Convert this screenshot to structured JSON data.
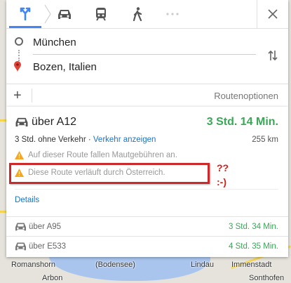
{
  "map": {
    "labels": [
      "Romanshorn",
      "(Bodensee)",
      "Lindau",
      "Immenstadt",
      "Arbon",
      "Sonthofen"
    ]
  },
  "modes": [
    {
      "name": "best-mode-icon",
      "active": true
    },
    {
      "name": "car-icon",
      "active": false
    },
    {
      "name": "transit-icon",
      "active": false
    },
    {
      "name": "walk-icon",
      "active": false
    },
    {
      "name": "more-icon",
      "active": false
    }
  ],
  "waypoints": {
    "origin": "München",
    "destination": "Bozen, Italien"
  },
  "options": {
    "route_options_label": "Routenoptionen"
  },
  "route1": {
    "via": "über A12",
    "time": "3 Std. 14 Min.",
    "traffic_note": "3 Std. ohne Verkehr ·",
    "traffic_link": "Verkehr anzeigen",
    "distance": "255 km",
    "warning_toll": "Auf dieser Route fallen Mautgebühren an.",
    "warning_austria": "Diese Route verläuft durch Österreich.",
    "details_link": "Details"
  },
  "annotation": {
    "line1": "??",
    "line2": ":-)"
  },
  "alternatives": [
    {
      "via": "über A95",
      "time": "3 Std. 34 Min."
    },
    {
      "via": "über E533",
      "time": "4 Std. 35 Min."
    }
  ],
  "colors": {
    "accent": "#4285f4",
    "time_green": "#3aa757",
    "link_blue": "#1a73c8",
    "highlight_red": "#cc2a2a"
  }
}
